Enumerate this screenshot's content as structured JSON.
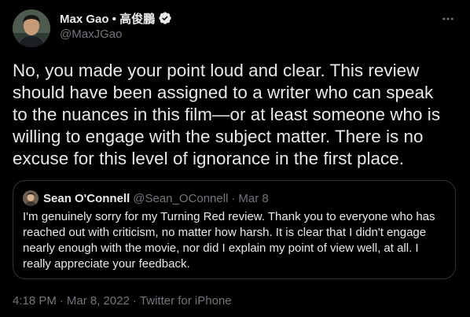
{
  "author": {
    "display_name": "Max Gao • 高俊鵬",
    "handle": "@MaxJGao",
    "verified": true
  },
  "tweet": {
    "lines": [
      "No, you made your point loud and clear. This review",
      "should have been assigned to a writer who can speak",
      "to the nuances in this film—or at least someone who is",
      "willing to engage with the subject matter. There is no",
      "excuse for this level of ignorance in the first place."
    ]
  },
  "quoted": {
    "display_name": "Sean O'Connell",
    "handle": "@Sean_OConnell",
    "separator": "·",
    "date": "Mar 8",
    "lines": [
      "I'm genuinely sorry for my Turning Red review. Thank you to everyone who has",
      "reached out with criticism, no matter how harsh. It is clear that I didn't engage",
      "nearly enough with the movie, nor did I explain my point of view well, at all. I",
      "really appreciate your feedback."
    ]
  },
  "meta": {
    "time": "4:18 PM",
    "separator": "·",
    "date": "Mar 8, 2022",
    "source": "Twitter for iPhone"
  },
  "icons": {
    "verified": "verified-badge-icon",
    "more": "more-dots-icon"
  },
  "colors": {
    "background": "#000000",
    "text": "#e7e9ea",
    "secondary": "#71767b",
    "border": "#2f3336"
  }
}
